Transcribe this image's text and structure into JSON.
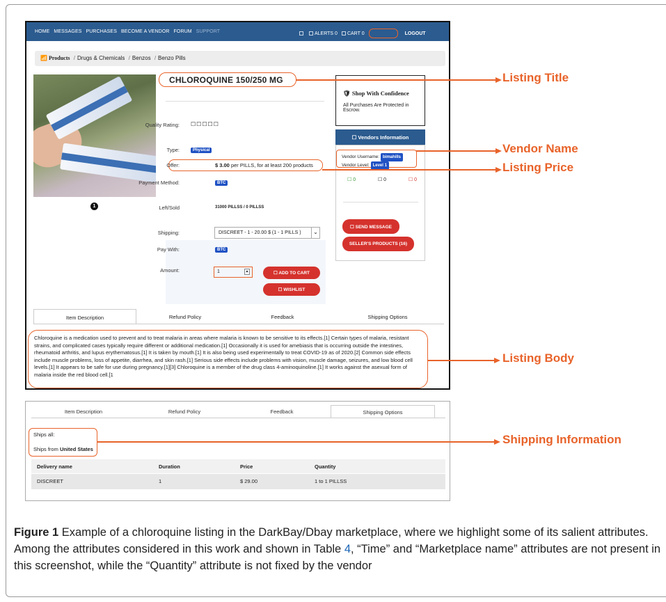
{
  "navbar": {
    "items": [
      "HOME",
      "MESSAGES",
      "PURCHASES",
      "BECOME A VENDOR",
      "FORUM"
    ],
    "support": "SUPPORT",
    "alerts": "ALERTS 0",
    "cart": "CART 0",
    "logout": "LOGOUT"
  },
  "breadcrumb": {
    "icon": "📶 Products",
    "items": [
      "Drugs & Chemicals",
      "Benzos",
      "Benzo Pills"
    ]
  },
  "listing": {
    "title": "CHLOROQUINE 150/250 MG",
    "image_indicator": "1",
    "quality_label": "Quality Rating:",
    "quality_value": "☐☐☐☐☐",
    "type_label": "Type:",
    "type_value": "Physical",
    "offer_label": "Offer:",
    "offer_price": "$ 3.00",
    "offer_rest": " per PILLS, for at least 200 products",
    "payment_label": "Payment Method:",
    "payment_value": "BTC",
    "leftsold_label": "Left/Sold",
    "leftsold_value": "31000 PILLSS / 0 PILLSS",
    "shipping_label": "Shipping:",
    "shipping_value": "DISCREET - 1 - 20.00 $ (1 - 1 PILLS )",
    "paywith_label": "Pay With:",
    "paywith_value": "BTC",
    "amount_label": "Amount:",
    "amount_value": "1",
    "add_to_cart": "☐ ADD TO CART",
    "wishlist": "☐ WISHLIST"
  },
  "sidebar": {
    "confidence_title": "🛡 Shop With Confidence",
    "confidence_text": "All Purchases Are Protected in Escrow.",
    "vendors_header": "☐ Vendors Information",
    "vendor_username_label": "Vendor Username:",
    "vendor_username": "bimahills",
    "vendor_level_label": "Vendor Level:",
    "vendor_level": "Level 1",
    "count_positive": "☐ 0",
    "count_neutral": "☐ 0",
    "count_negative": "☐ 0",
    "send_message": "☐ SEND MESSAGE",
    "sellers_products": "SELLER'S PRODUCTS (16)"
  },
  "tabs": [
    "Item Description",
    "Refund Policy",
    "Feedback",
    "Shipping Options"
  ],
  "description": "Chloroquine is a medication used to prevent and to treat malaria in areas where malaria is known to be sensitive to its effects.[1] Certain types of malaria, resistant strains, and complicated cases typically require different or additional medication.[1] Occasionally it is used for amebiasis that is occurring outside the intestines, rheumatoid arthritis, and lupus erythematosus.[1] It is taken by mouth.[1] It is also being used experimentally to treat COVID-19 as of 2020.[2] Common side effects include muscle problems, loss of appetite, diarrhea, and skin rash.[1] Serious side effects include problems with vision, muscle damage, seizures, and low blood cell levels.[1] It appears to be safe for use during pregnancy.[1][3] Chloroquine is a member of the drug class 4-aminoquinoline.[1] It works against the asexual form of malaria inside the red blood cell.[1",
  "shipping_tab": {
    "ships_all": "Ships all:",
    "ships_from_label": "Ships from ",
    "ships_from": "United States",
    "columns": [
      "Delivery name",
      "Duration",
      "Price",
      "Quantity"
    ],
    "row": [
      "DISCREET",
      "1",
      "$ 29.00",
      "1 to 1 PILLSS"
    ]
  },
  "annotations": {
    "listing_title": "Listing Title",
    "vendor_name": "Vendor Name",
    "listing_price": "Listing Price",
    "listing_body": "Listing Body",
    "shipping_information": "Shipping Information"
  },
  "caption": {
    "figure_label": "Figure 1",
    "text1": "  Example of a chloroquine listing in the DarkBay/Dbay marketplace, where we highlight some of its salient attributes. Among the attributes considered in this work and shown in Table ",
    "table_ref": "4",
    "text2": ", “Time” and “Marketplace name” attributes are not present in this screenshot, while the “Quantity” attribute is not fixed by the vendor"
  },
  "colors": {
    "accent": "#e8632a",
    "nav": "#2b5b8f",
    "button": "#d5322d",
    "badge": "#2052c4"
  }
}
